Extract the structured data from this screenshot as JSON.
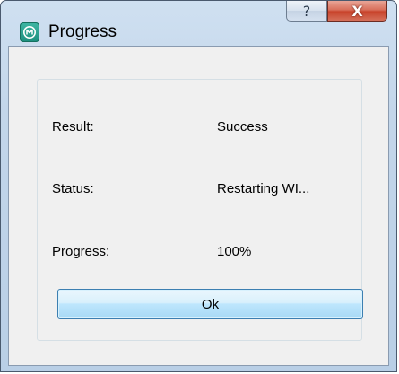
{
  "window": {
    "title": "Progress",
    "help_label": "?",
    "close_label": "X"
  },
  "rows": [
    {
      "label": "Result:",
      "value": "Success"
    },
    {
      "label": "Status:",
      "value": "Restarting WI..."
    },
    {
      "label": "Progress:",
      "value": "100%"
    }
  ],
  "ok_label": "Ok",
  "colors": {
    "accent": "#1c8f7e",
    "close": "#c8432b",
    "button_border": "#3c7fb1"
  }
}
